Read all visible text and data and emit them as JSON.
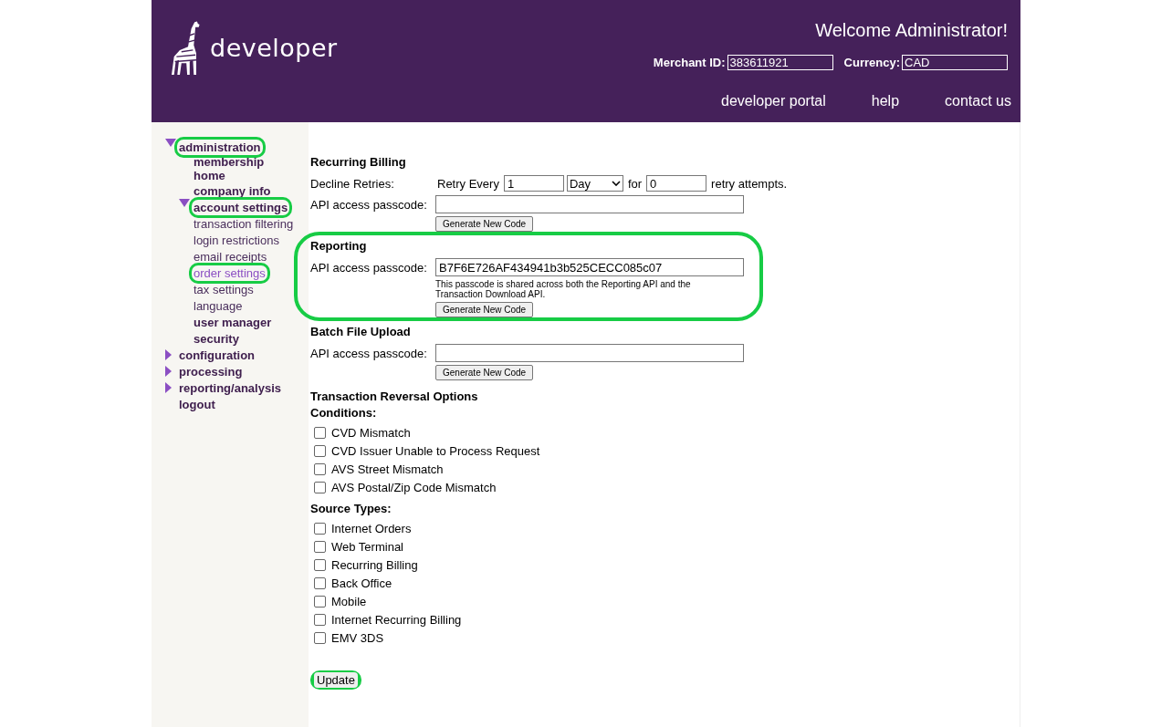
{
  "header": {
    "logo_text": "developer",
    "welcome": "Welcome Administrator!",
    "merchant_id": {
      "label": "Merchant ID:",
      "value": "383611921"
    },
    "currency": {
      "label": "Currency:",
      "value": "CAD"
    },
    "links": [
      "developer portal",
      "help",
      "contact us"
    ]
  },
  "sidebar": {
    "items": [
      {
        "label": "administration",
        "kind": "section",
        "expanded": true,
        "selected": false,
        "highlighted": true,
        "children": [
          {
            "label": "membership home",
            "kind": "section",
            "selected": false,
            "highlighted": false
          },
          {
            "label": "company info",
            "kind": "section",
            "selected": false,
            "highlighted": false
          },
          {
            "label": "account settings",
            "kind": "section",
            "expanded": true,
            "selected": false,
            "highlighted": true,
            "children": [
              {
                "label": "transaction filtering",
                "kind": "link",
                "selected": false,
                "highlighted": false
              },
              {
                "label": "login restrictions",
                "kind": "link",
                "selected": false,
                "highlighted": false
              },
              {
                "label": "email receipts",
                "kind": "link",
                "selected": false,
                "highlighted": false
              },
              {
                "label": "order settings",
                "kind": "link",
                "selected": true,
                "highlighted": true
              },
              {
                "label": "tax settings",
                "kind": "link",
                "selected": false,
                "highlighted": false
              },
              {
                "label": "language",
                "kind": "link",
                "selected": false,
                "highlighted": false
              }
            ]
          },
          {
            "label": "user manager",
            "kind": "section",
            "selected": false,
            "highlighted": false
          },
          {
            "label": "security",
            "kind": "section",
            "selected": false,
            "highlighted": false
          }
        ]
      },
      {
        "label": "configuration",
        "kind": "section",
        "expanded": false,
        "selected": false,
        "highlighted": false
      },
      {
        "label": "processing",
        "kind": "section",
        "expanded": false,
        "selected": false,
        "highlighted": false
      },
      {
        "label": "reporting/analysis",
        "kind": "section",
        "expanded": false,
        "selected": false,
        "highlighted": false
      },
      {
        "label": "logout",
        "kind": "section",
        "selected": false,
        "highlighted": false
      }
    ]
  },
  "recurring_billing": {
    "title": "Recurring Billing",
    "decline_label": "Decline Retries:",
    "retry_every": "Retry Every",
    "interval": "1",
    "unit": "Day",
    "for": "for",
    "attempts": "0",
    "attempts_suffix": "retry attempts.",
    "passcode_label": "API access passcode:",
    "button": "Generate New Code"
  },
  "reporting": {
    "title": "Reporting",
    "highlighted": true,
    "passcode_label": "API access passcode:",
    "passcode": "B7F6E726AF434941b3b525CECC085c07",
    "note": "This passcode is shared across both the Reporting API and the Transaction Download API.",
    "button": "Generate New Code"
  },
  "batch_file_upload": {
    "title": "Batch File Upload",
    "passcode_label": "API access passcode:",
    "button": "Generate New Code"
  },
  "reversal": {
    "title": "Transaction Reversal Options",
    "groups": [
      {
        "title": "Conditions:",
        "options": [
          {
            "label": "CVD Mismatch",
            "checked": false
          },
          {
            "label": "CVD Issuer Unable to Process Request",
            "checked": false
          },
          {
            "label": "AVS Street Mismatch",
            "checked": false
          },
          {
            "label": "AVS Postal/Zip Code Mismatch",
            "checked": false
          }
        ]
      },
      {
        "title": "Source Types:",
        "options": [
          {
            "label": "Internet Orders",
            "checked": false
          },
          {
            "label": "Web Terminal",
            "checked": false
          },
          {
            "label": "Recurring Billing",
            "checked": false
          },
          {
            "label": "Back Office",
            "checked": false
          },
          {
            "label": "Mobile",
            "checked": false
          },
          {
            "label": "Internet Recurring Billing",
            "checked": false
          },
          {
            "label": "EMV 3DS",
            "checked": false
          }
        ]
      }
    ]
  },
  "update_button": {
    "label": "Update",
    "highlighted": true
  }
}
